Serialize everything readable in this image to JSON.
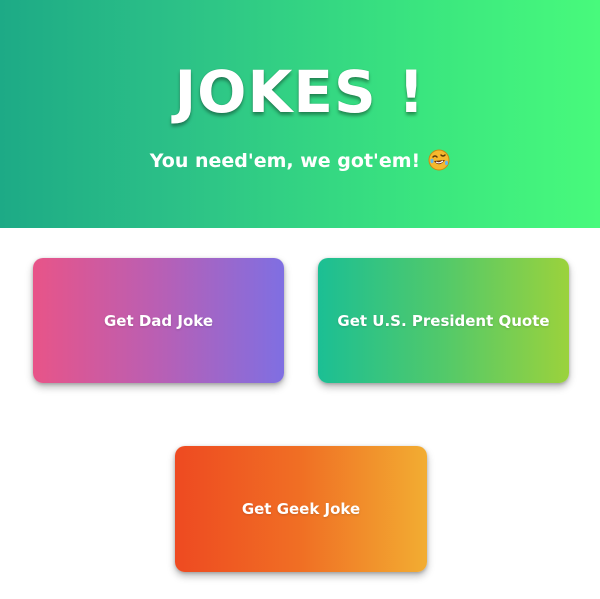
{
  "header": {
    "title": "JOKES !",
    "subtitle": "You need'em, we got'em!",
    "emoji_icon": "rolling-on-floor-laughing-emoji"
  },
  "buttons": {
    "dad_joke": "Get Dad Joke",
    "president_quote": "Get U.S. President Quote",
    "geek_joke": "Get Geek Joke"
  },
  "colors": {
    "hero_start": "#1daa86",
    "hero_end": "#48fa7c",
    "dad_start": "#e85488",
    "dad_end": "#7f6fe2",
    "president_start": "#1bbf94",
    "president_end": "#9bd23c",
    "geek_start": "#ee4a21",
    "geek_end": "#f2ad32"
  }
}
